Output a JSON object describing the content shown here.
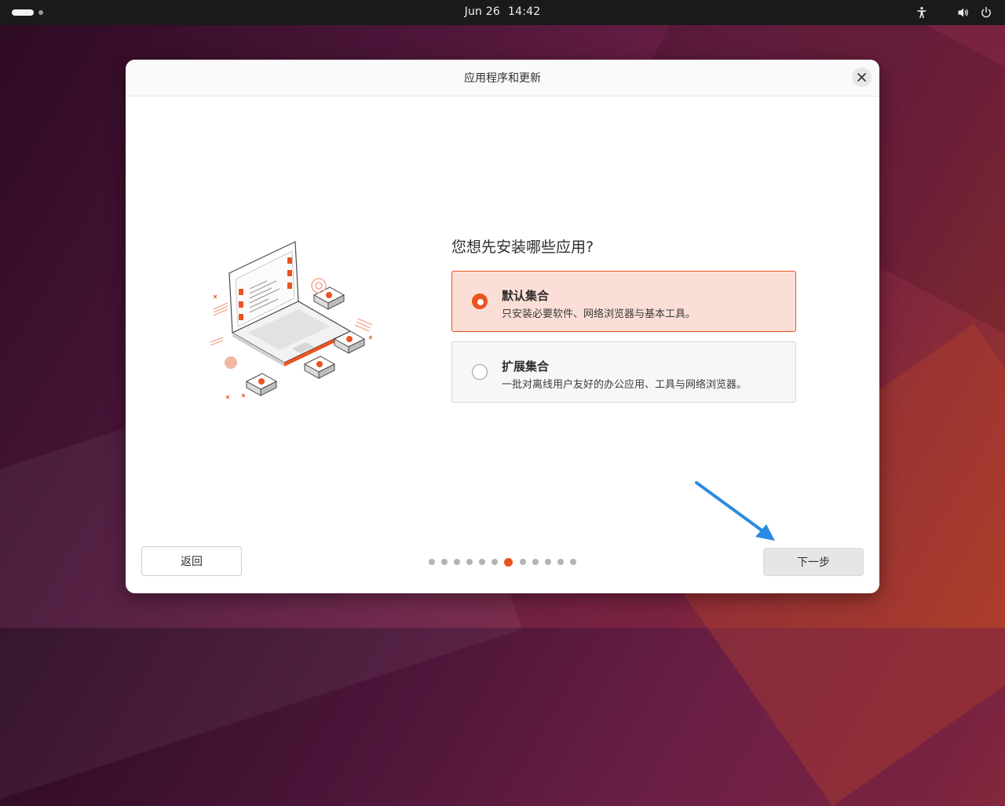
{
  "topbar": {
    "date": "Jun 26",
    "time": "14:42",
    "icons": [
      "workspace-indicator-icon",
      "accessibility-icon",
      "volume-icon",
      "power-icon"
    ]
  },
  "window": {
    "title": "应用程序和更新",
    "question": "您想先安装哪些应用?",
    "options": [
      {
        "title": "默认集合",
        "description": "只安装必要软件、网络浏览器与基本工具。",
        "selected": true
      },
      {
        "title": "扩展集合",
        "description": "一批对离线用户友好的办公应用、工具与网络浏览器。",
        "selected": false
      }
    ],
    "back_label": "返回",
    "next_label": "下一步",
    "progress": {
      "total": 12,
      "current": 7
    }
  },
  "colors": {
    "accent": "#e95420",
    "selected_bg": "#fbdfd6",
    "annotation_arrow": "#2a8be0"
  }
}
